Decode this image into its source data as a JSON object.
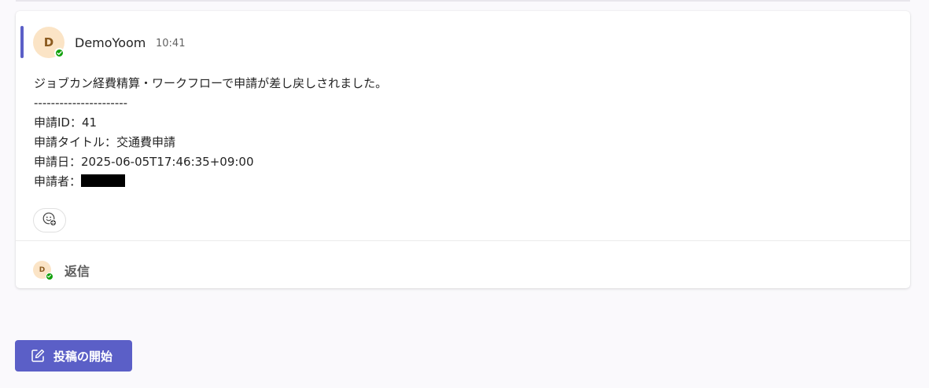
{
  "message": {
    "sender_initial": "D",
    "sender_name": "DemoYoom",
    "time": "10:41",
    "lines": [
      "ジョブカン経費精算・ワークフローで申請が差し戻しされました。",
      "----------------------",
      "申請ID：41",
      "申請タイトル：交通費申請",
      "申請日：2025-06-05T17:46:35+09:00",
      "申請者："
    ]
  },
  "reply": {
    "avatar_initial": "D",
    "label": "返信"
  },
  "compose": {
    "label": "投稿の開始"
  },
  "icons": {
    "reaction": "emoji-add-icon",
    "compose": "compose-icon",
    "presence": "presence-available-icon"
  },
  "colors": {
    "accent": "#5b5fc7",
    "avatar_bg": "#fbe4c6",
    "presence": "#13a10e"
  }
}
